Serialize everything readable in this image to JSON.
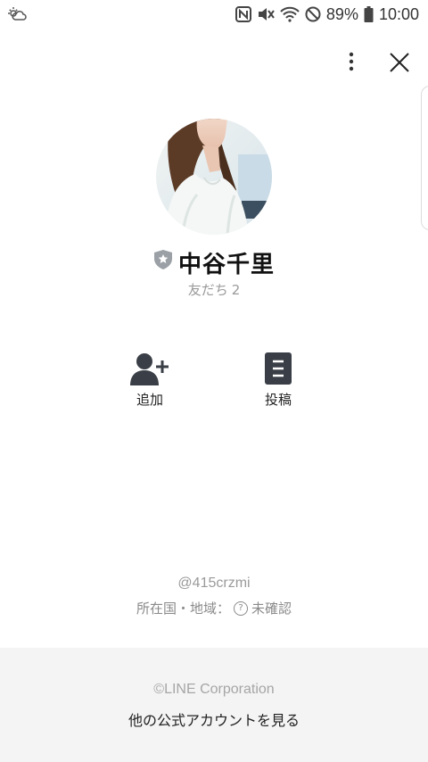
{
  "status_bar": {
    "battery_percent": "89%",
    "time": "10:00",
    "icons": [
      "weather-cloud-icon",
      "nfc-icon",
      "mute-icon",
      "wifi-icon",
      "block-icon",
      "battery-icon"
    ]
  },
  "profile": {
    "name": "中谷千里",
    "friends_label": "友だち",
    "friends_count": "2",
    "badge_icon": "shield-star-icon"
  },
  "actions": {
    "add_label": "追加",
    "post_label": "投稿"
  },
  "account": {
    "id": "@415crzmi",
    "country_label": "所在国・地域：",
    "country_value": "未確認"
  },
  "footer": {
    "copyright": "©LINE Corporation",
    "other_accounts_link": "他の公式アカウントを見る"
  },
  "colors": {
    "background": "#ffffff",
    "footer_bg": "#f4f4f4",
    "muted_text": "#9a9a9a",
    "icon_dark": "#3a3f47"
  }
}
